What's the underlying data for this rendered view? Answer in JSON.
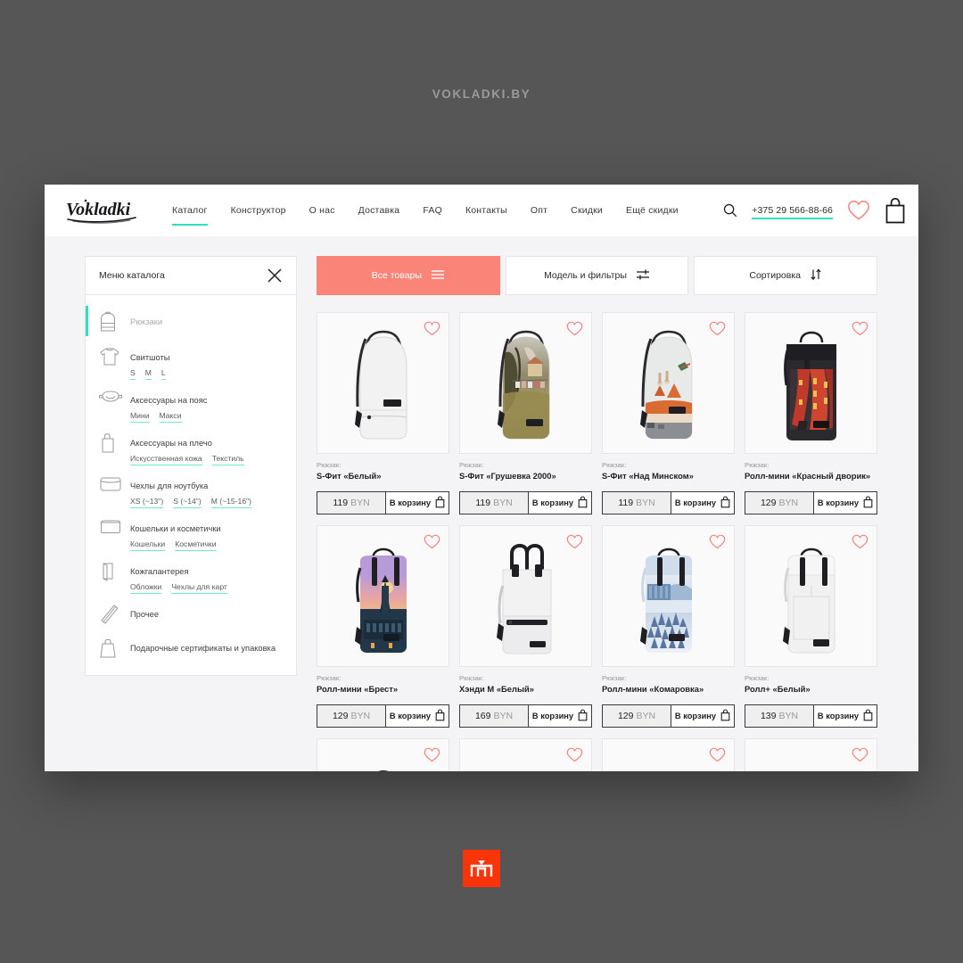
{
  "watermark": "VOKLADKI.BY",
  "header": {
    "logo_text": "Vokladki",
    "nav": [
      {
        "label": "Каталог",
        "active": true
      },
      {
        "label": "Конструктор",
        "active": false
      },
      {
        "label": "О нас",
        "active": false
      },
      {
        "label": "Доставка",
        "active": false
      },
      {
        "label": "FAQ",
        "active": false
      },
      {
        "label": "Контакты",
        "active": false
      },
      {
        "label": "Опт",
        "active": false
      },
      {
        "label": "Скидки",
        "active": false
      },
      {
        "label": "Ещё скидки",
        "active": false
      }
    ],
    "search_icon": "search-icon",
    "phone": "+375 29 566-88-66",
    "favorites_icon": "heart-icon",
    "cart_icon": "shopping-bag-icon",
    "accent_teal": "#2fe0bf",
    "accent_pink": "#f5827e"
  },
  "sidebar": {
    "title": "Меню каталога",
    "close_icon": "close-icon",
    "items": [
      {
        "label": "Рюкзаки",
        "icon": "backpack-icon",
        "active": true,
        "subs": []
      },
      {
        "label": "Свитшоты",
        "icon": "sweatshirt-icon",
        "active": false,
        "subs": [
          "S",
          "M",
          "L"
        ]
      },
      {
        "label": "Аксессуары на пояс",
        "icon": "beltbag-icon",
        "active": false,
        "subs": [
          "Мини",
          "Макси"
        ]
      },
      {
        "label": "Аксессуары на плечо",
        "icon": "shoulderbag-icon",
        "active": false,
        "subs": [
          "Искусственная кожа",
          "Текстиль"
        ]
      },
      {
        "label": "Чехлы для ноутбука",
        "icon": "laptopsleeve-icon",
        "active": false,
        "subs": [
          "XS (~13\")",
          "S (~14\")",
          "M (~15-16\")"
        ]
      },
      {
        "label": "Кошельки и косметички",
        "icon": "wallet-icon",
        "active": false,
        "subs": [
          "Кошельки",
          "Косметички"
        ]
      },
      {
        "label": "Кожгалантерея",
        "icon": "leathergoods-icon",
        "active": false,
        "subs": [
          "Обложки",
          "Чехлы для карт"
        ]
      },
      {
        "label": "Прочее",
        "icon": "misc-icon",
        "active": false,
        "subs": []
      },
      {
        "label": "Подарочные сертификаты и упаковка",
        "icon": "giftbag-icon",
        "active": false,
        "subs": []
      }
    ]
  },
  "tabs": [
    {
      "label": "Все товары",
      "icon": "hamburger-icon",
      "active": true
    },
    {
      "label": "Модель и фильтры",
      "icon": "sliders-icon",
      "active": false
    },
    {
      "label": "Сортировка",
      "icon": "sort-arrows-icon",
      "active": false
    }
  ],
  "products": [
    {
      "type": "Рюкзак:",
      "name": "S-Фит «Белый»",
      "price": "119",
      "currency": "BYN",
      "buy": "В корзину",
      "style": "plain-white",
      "shape": "dome"
    },
    {
      "type": "Рюкзак:",
      "name": "S-Фит «Грушевка 2000»",
      "price": "119",
      "currency": "BYN",
      "buy": "В корзину",
      "style": "print-grushevka",
      "shape": "dome"
    },
    {
      "type": "Рюкзак:",
      "name": "S-Фит «Над Минском»",
      "price": "119",
      "currency": "BYN",
      "buy": "В корзину",
      "style": "print-minsk",
      "shape": "dome"
    },
    {
      "type": "Рюкзак:",
      "name": "Ролл-мини «Красный дворик»",
      "price": "129",
      "currency": "BYN",
      "buy": "В корзину",
      "style": "print-red",
      "shape": "roll"
    },
    {
      "type": "Рюкзак:",
      "name": "Ролл-мини «Брест»",
      "price": "129",
      "currency": "BYN",
      "buy": "В корзину",
      "style": "print-brest",
      "shape": "roll"
    },
    {
      "type": "Рюкзак:",
      "name": "Хэнди М «Белый»",
      "price": "169",
      "currency": "BYN",
      "buy": "В корзину",
      "style": "plain-white",
      "shape": "handy"
    },
    {
      "type": "Рюкзак:",
      "name": "Ролл-мини «Комаровка»",
      "price": "129",
      "currency": "BYN",
      "buy": "В корзину",
      "style": "print-komarovka",
      "shape": "roll"
    },
    {
      "type": "Рюкзак:",
      "name": "Ролл+ «Белый»",
      "price": "139",
      "currency": "BYN",
      "buy": "В корзину",
      "style": "plain-white",
      "shape": "roll"
    }
  ],
  "partial_row": [
    {
      "style": "plain-black",
      "shape": "duffel"
    },
    {
      "style": "print-blue",
      "shape": "duffel"
    },
    {
      "style": "print-violet",
      "shape": "duffel"
    },
    {
      "style": "print-purple",
      "shape": "duffel"
    }
  ],
  "bottom_badge_icon": "m-logo-icon"
}
